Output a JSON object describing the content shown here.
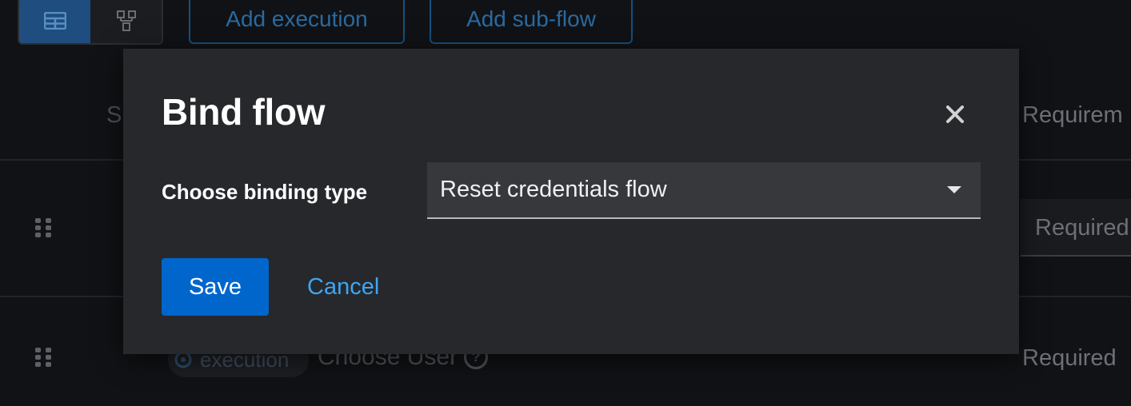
{
  "toolbar": {
    "view_toggle": [
      {
        "icon": "table-view-icon",
        "active": true
      },
      {
        "icon": "diagram-view-icon",
        "active": false
      }
    ],
    "add_execution_label": "Add execution",
    "add_sub_flow_label": "Add sub-flow"
  },
  "table": {
    "header_step_partial": "S",
    "header_requirement_partial": "Requirem",
    "rows": [
      {
        "requirement": "Required"
      },
      {
        "badge": "execution",
        "name": "Choose User",
        "requirement": "Required"
      }
    ]
  },
  "modal": {
    "title": "Bind flow",
    "close_icon": "close-icon",
    "field_label": "Choose binding type",
    "select_value": "Reset credentials flow",
    "save_label": "Save",
    "cancel_label": "Cancel"
  },
  "colors": {
    "primary": "#0066cc",
    "link": "#3ea6f2",
    "modal_bg": "#26282c",
    "page_bg": "#111215"
  }
}
